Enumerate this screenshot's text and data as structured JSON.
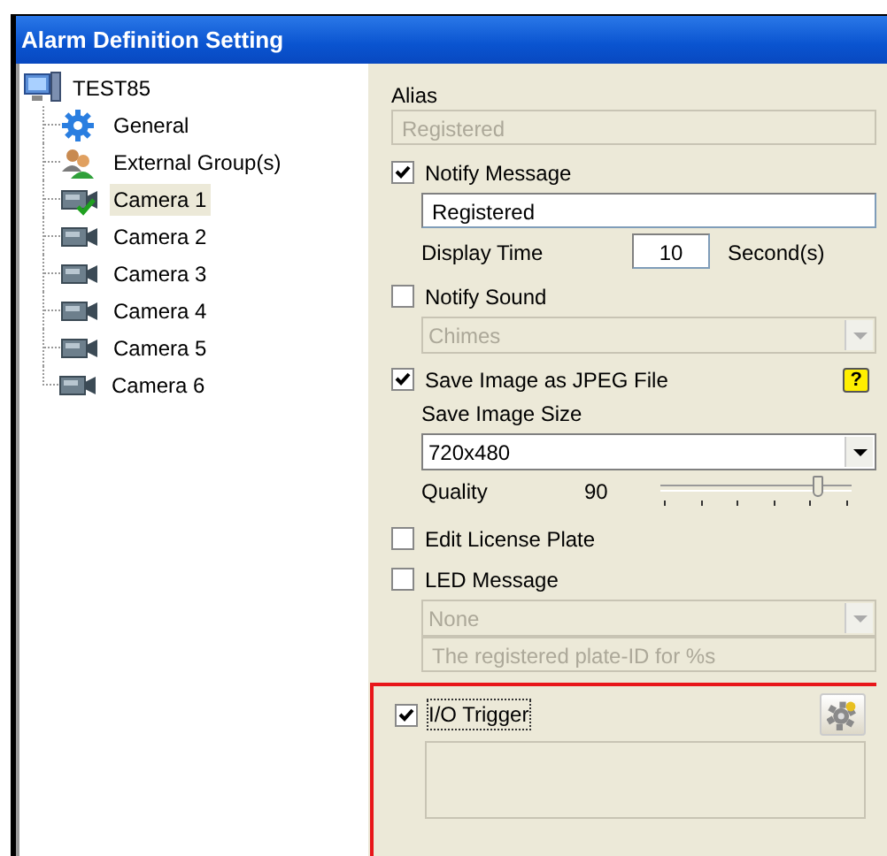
{
  "window": {
    "title": "Alarm Definition Setting"
  },
  "tree": {
    "label": "TEST85",
    "children": [
      {
        "label": "General",
        "kind": "gear",
        "selected": false,
        "checked": false
      },
      {
        "label": "External Group(s)",
        "kind": "group",
        "selected": false,
        "checked": false
      },
      {
        "label": "Camera 1",
        "kind": "camera",
        "selected": true,
        "checked": true
      },
      {
        "label": "Camera 2",
        "kind": "camera",
        "selected": false,
        "checked": false
      },
      {
        "label": "Camera 3",
        "kind": "camera",
        "selected": false,
        "checked": false
      },
      {
        "label": "Camera 4",
        "kind": "camera",
        "selected": false,
        "checked": false
      },
      {
        "label": "Camera 5",
        "kind": "camera",
        "selected": false,
        "checked": false
      },
      {
        "label": "Camera 6",
        "kind": "camera",
        "selected": false,
        "checked": false
      }
    ]
  },
  "alias": {
    "label": "Alias",
    "value": "Registered",
    "disabled": true
  },
  "notify_message": {
    "label": "Notify Message",
    "checked": true,
    "value": "Registered",
    "display_time_label": "Display Time",
    "display_time": "10",
    "unit": "Second(s)"
  },
  "notify_sound": {
    "label": "Notify Sound",
    "checked": false,
    "value": "Chimes"
  },
  "save_image": {
    "label": "Save Image as JPEG File",
    "checked": true,
    "help": "?",
    "size_label": "Save Image Size",
    "size": "720x480",
    "quality_label": "Quality",
    "quality": "90",
    "level": 0.83
  },
  "edit_license_plate": {
    "label": "Edit License Plate",
    "checked": false
  },
  "led_message": {
    "label": "LED Message",
    "checked": false,
    "value": "None",
    "text": "The registered plate-ID for %s"
  },
  "io_trigger": {
    "label": "I/O Trigger",
    "checked": true,
    "highlighted": true
  }
}
